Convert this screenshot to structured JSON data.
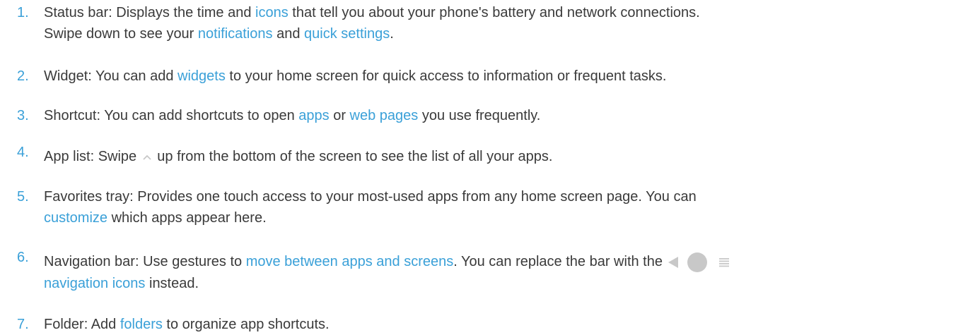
{
  "items": [
    {
      "num": "1.",
      "parts": [
        {
          "t": "Status bar: Displays the time and "
        },
        {
          "t": "icons",
          "link": true
        },
        {
          "t": " that tell you about your phone's battery and network connections."
        },
        {
          "br": true
        },
        {
          "t": "Swipe down to see your "
        },
        {
          "t": "notifications",
          "link": true
        },
        {
          "t": " and "
        },
        {
          "t": "quick settings",
          "link": true
        },
        {
          "t": "."
        }
      ]
    },
    {
      "num": "2.",
      "parts": [
        {
          "t": "Widget: You can add "
        },
        {
          "t": "widgets",
          "link": true
        },
        {
          "t": " to your home screen for quick access to information or frequent tasks."
        }
      ]
    },
    {
      "num": "3.",
      "parts": [
        {
          "t": "Shortcut: You can add shortcuts to open "
        },
        {
          "t": "apps",
          "link": true
        },
        {
          "t": " or "
        },
        {
          "t": "web pages",
          "link": true
        },
        {
          "t": " you use frequently."
        }
      ]
    },
    {
      "num": "4.",
      "raised": true,
      "parts": [
        {
          "t": "App list: Swipe "
        },
        {
          "icon": "swipe-up-chevron-icon"
        },
        {
          "t": " up from the bottom of the screen to see the list of all your apps."
        }
      ]
    },
    {
      "num": "5.",
      "parts": [
        {
          "t": "Favorites tray: Provides one touch access to your most-used apps from any home screen page. You can"
        },
        {
          "br": true
        },
        {
          "t": "customize",
          "link": true
        },
        {
          "t": " which apps appear here."
        }
      ]
    },
    {
      "num": "6.",
      "raised": true,
      "parts": [
        {
          "t": "Navigation bar: Use gestures to "
        },
        {
          "t": "move between apps and screens",
          "link": true
        },
        {
          "t": ". You can replace the bar with the"
        },
        {
          "icon": "nav-buttons-icons"
        },
        {
          "br": true
        },
        {
          "t": "navigation icons",
          "link": true
        },
        {
          "t": " instead."
        }
      ]
    },
    {
      "num": "7.",
      "parts": [
        {
          "t": "Folder: Add "
        },
        {
          "t": "folders",
          "link": true
        },
        {
          "t": " to organize app shortcuts."
        }
      ]
    }
  ],
  "colors": {
    "text": "#3a3a3a",
    "accent": "#3aa0d8",
    "icon_gray": "#c8c8c8"
  }
}
